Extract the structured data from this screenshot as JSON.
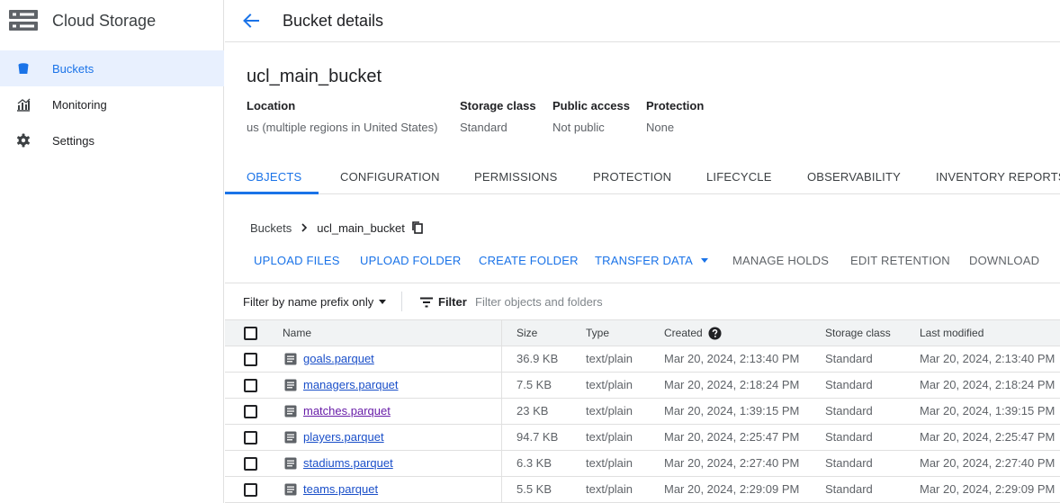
{
  "app": {
    "title": "Cloud Storage",
    "nav": [
      {
        "label": "Buckets",
        "icon": "bucket-icon",
        "active": true
      },
      {
        "label": "Monitoring",
        "icon": "monitoring-chart-icon",
        "active": false
      },
      {
        "label": "Settings",
        "icon": "gear-icon",
        "active": false
      }
    ]
  },
  "header": {
    "title": "Bucket details"
  },
  "bucket": {
    "name": "ucl_main_bucket",
    "info": [
      {
        "label": "Location",
        "value": "us (multiple regions in United States)"
      },
      {
        "label": "Storage class",
        "value": "Standard"
      },
      {
        "label": "Public access",
        "value": "Not public"
      },
      {
        "label": "Protection",
        "value": "None"
      }
    ]
  },
  "tabs": [
    {
      "label": "OBJECTS",
      "active": true
    },
    {
      "label": "CONFIGURATION",
      "active": false
    },
    {
      "label": "PERMISSIONS",
      "active": false
    },
    {
      "label": "PROTECTION",
      "active": false
    },
    {
      "label": "LIFECYCLE",
      "active": false
    },
    {
      "label": "OBSERVABILITY",
      "active": false
    },
    {
      "label": "INVENTORY REPORTS",
      "active": false
    }
  ],
  "breadcrumb": {
    "root": "Buckets",
    "current": "ucl_main_bucket"
  },
  "actions": [
    {
      "label": "UPLOAD FILES",
      "enabled": true
    },
    {
      "label": "UPLOAD FOLDER",
      "enabled": true
    },
    {
      "label": "CREATE FOLDER",
      "enabled": true
    },
    {
      "label": "TRANSFER DATA",
      "enabled": true,
      "dropdown": true
    },
    {
      "label": "MANAGE HOLDS",
      "enabled": false
    },
    {
      "label": "EDIT RETENTION",
      "enabled": false
    },
    {
      "label": "DOWNLOAD",
      "enabled": false
    }
  ],
  "filter": {
    "mode": "Filter by name prefix only",
    "label": "Filter",
    "placeholder": "Filter objects and folders"
  },
  "table": {
    "columns": [
      "Name",
      "Size",
      "Type",
      "Created",
      "Storage class",
      "Last modified"
    ],
    "rows": [
      {
        "name": "goals.parquet",
        "size": "36.9 KB",
        "type": "text/plain",
        "created": "Mar 20, 2024, 2:13:40 PM",
        "storage_class": "Standard",
        "last_modified": "Mar 20, 2024, 2:13:40 PM",
        "visited": false
      },
      {
        "name": "managers.parquet",
        "size": "7.5 KB",
        "type": "text/plain",
        "created": "Mar 20, 2024, 2:18:24 PM",
        "storage_class": "Standard",
        "last_modified": "Mar 20, 2024, 2:18:24 PM",
        "visited": false
      },
      {
        "name": "matches.parquet",
        "size": "23 KB",
        "type": "text/plain",
        "created": "Mar 20, 2024, 1:39:15 PM",
        "storage_class": "Standard",
        "last_modified": "Mar 20, 2024, 1:39:15 PM",
        "visited": true
      },
      {
        "name": "players.parquet",
        "size": "94.7 KB",
        "type": "text/plain",
        "created": "Mar 20, 2024, 2:25:47 PM",
        "storage_class": "Standard",
        "last_modified": "Mar 20, 2024, 2:25:47 PM",
        "visited": false
      },
      {
        "name": "stadiums.parquet",
        "size": "6.3 KB",
        "type": "text/plain",
        "created": "Mar 20, 2024, 2:27:40 PM",
        "storage_class": "Standard",
        "last_modified": "Mar 20, 2024, 2:27:40 PM",
        "visited": false
      },
      {
        "name": "teams.parquet",
        "size": "5.5 KB",
        "type": "text/plain",
        "created": "Mar 20, 2024, 2:29:09 PM",
        "storage_class": "Standard",
        "last_modified": "Mar 20, 2024, 2:29:09 PM",
        "visited": false
      }
    ]
  },
  "colors": {
    "accent": "#1a73e8",
    "link": "#1a4fc9",
    "visited_link": "#681da8",
    "nav_active_bg": "#e8f0fe"
  }
}
